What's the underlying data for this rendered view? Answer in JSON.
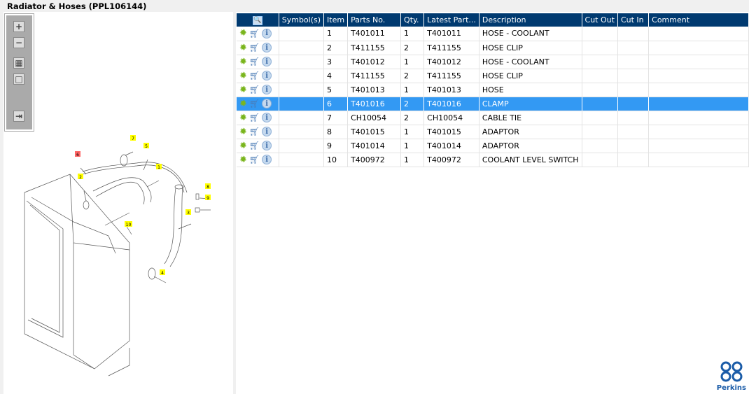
{
  "title": "Radiator & Hoses (PPL106144)",
  "toolbar": {
    "zoom_in": "+",
    "zoom_out": "−",
    "fit_all": "▦",
    "fit_box": "□",
    "toggle_panel": "⇥"
  },
  "table": {
    "columns": [
      "",
      "Symbol(s)",
      "Item",
      "Parts No.",
      "Qty.",
      "Latest Part...",
      "Description",
      "Cut Out",
      "Cut In",
      "Comment"
    ],
    "rows": [
      {
        "item": "1",
        "part": "T401011",
        "qty": "1",
        "latest": "T401011",
        "desc": "HOSE - COOLANT"
      },
      {
        "item": "2",
        "part": "T411155",
        "qty": "2",
        "latest": "T411155",
        "desc": "HOSE CLIP"
      },
      {
        "item": "3",
        "part": "T401012",
        "qty": "1",
        "latest": "T401012",
        "desc": "HOSE - COOLANT"
      },
      {
        "item": "4",
        "part": "T411155",
        "qty": "2",
        "latest": "T411155",
        "desc": "HOSE CLIP"
      },
      {
        "item": "5",
        "part": "T401013",
        "qty": "1",
        "latest": "T401013",
        "desc": "HOSE"
      },
      {
        "item": "6",
        "part": "T401016",
        "qty": "2",
        "latest": "T401016",
        "desc": "CLAMP",
        "selected": true
      },
      {
        "item": "7",
        "part": "CH10054",
        "qty": "2",
        "latest": "CH10054",
        "desc": "CABLE TIE"
      },
      {
        "item": "8",
        "part": "T401015",
        "qty": "1",
        "latest": "T401015",
        "desc": "ADAPTOR"
      },
      {
        "item": "9",
        "part": "T401014",
        "qty": "1",
        "latest": "T401014",
        "desc": "ADAPTOR"
      },
      {
        "item": "10",
        "part": "T400972",
        "qty": "1",
        "latest": "T400972",
        "desc": "COOLANT LEVEL SWITCH"
      }
    ]
  },
  "callouts": [
    "7",
    "5",
    "6",
    "1",
    "2",
    "8",
    "9",
    "3",
    "10",
    "4"
  ],
  "colors": {
    "header": "#003a70",
    "selected": "#3399f3",
    "callout": "#ffff00",
    "callout_selected": "#ff6666"
  },
  "logo": {
    "text": "Perkins"
  }
}
